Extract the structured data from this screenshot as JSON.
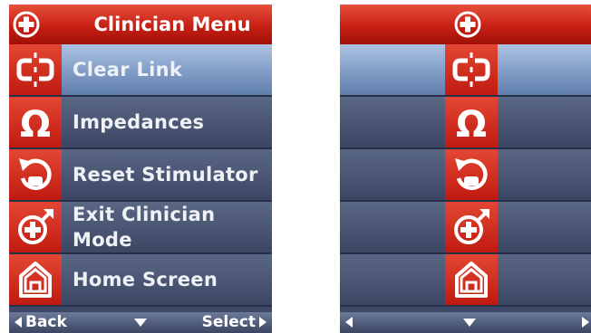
{
  "left_screen": {
    "header": {
      "title": "Clinician Menu",
      "icon": "plus-circle-icon"
    },
    "items": [
      {
        "label": "Clear Link",
        "icon": "clear-link-icon",
        "selected": true
      },
      {
        "label": "Impedances",
        "icon": "omega-icon",
        "selected": false
      },
      {
        "label": "Reset Stimulator",
        "icon": "reset-icon",
        "selected": false
      },
      {
        "label": "Exit Clinician Mode",
        "icon": "exit-plus-icon",
        "selected": false
      },
      {
        "label": "Home Screen",
        "icon": "home-icon",
        "selected": false
      }
    ],
    "footer": {
      "back_label": "Back",
      "select_label": "Select"
    }
  },
  "right_screen": {
    "header": {
      "icon": "plus-circle-icon"
    },
    "items": [
      {
        "icon": "clear-link-icon",
        "selected": true
      },
      {
        "icon": "omega-icon",
        "selected": false
      },
      {
        "icon": "reset-icon",
        "selected": false
      },
      {
        "icon": "exit-plus-icon",
        "selected": false
      },
      {
        "icon": "home-icon",
        "selected": false
      }
    ]
  },
  "colors": {
    "header_red": "#c81f14",
    "row_blue": "#3c4866",
    "selected_blue": "#7f9cc6"
  }
}
